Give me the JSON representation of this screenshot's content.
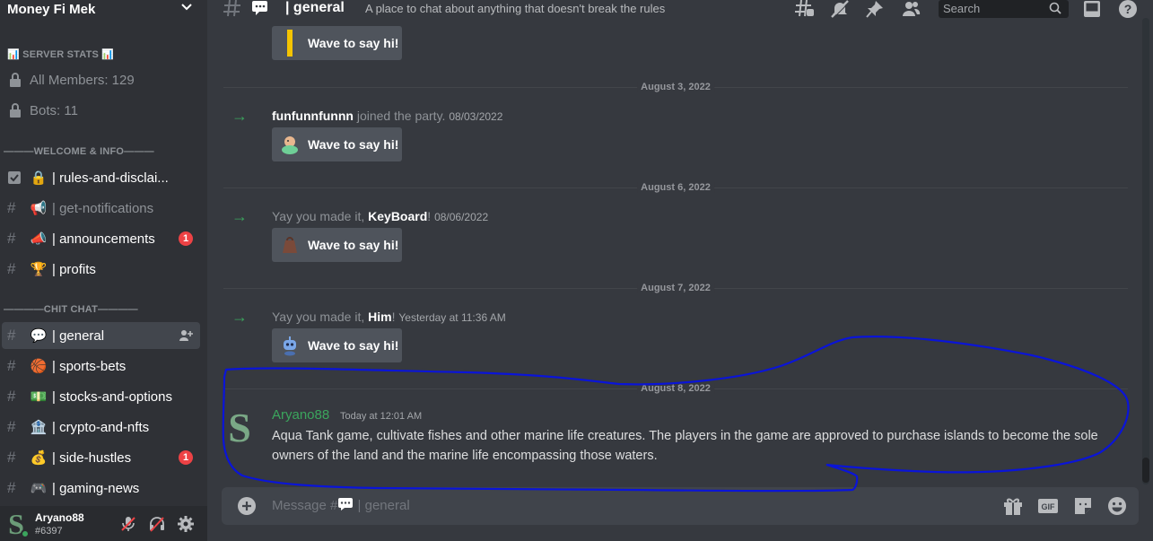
{
  "server": {
    "name": "Money Fi Mek"
  },
  "sidebar": {
    "stats_category": "📊 SERVER STATS 📊",
    "stats": [
      "All Members: 129",
      "Bots: 11"
    ],
    "welcome_category": "———WELCOME & INFO———",
    "welcome_channels": [
      {
        "label": "| rules-and-disclai...",
        "emoji": "🔒"
      },
      {
        "label": "| get-notifications",
        "emoji": "📢"
      },
      {
        "label": "| announcements",
        "emoji": "📣",
        "badge": "1"
      },
      {
        "label": "| profits",
        "emoji": "🏆"
      }
    ],
    "chat_category": "————CHIT CHAT————",
    "chat_channels": [
      {
        "label": "| general",
        "emoji": "💬",
        "active": true
      },
      {
        "label": "| sports-bets",
        "emoji": "🏀"
      },
      {
        "label": "| stocks-and-options",
        "emoji": "💵"
      },
      {
        "label": "| crypto-and-nfts",
        "emoji": "🏦"
      },
      {
        "label": "| side-hustles",
        "emoji": "💰",
        "badge": "1"
      },
      {
        "label": "| gaming-news",
        "emoji": "🎮"
      }
    ]
  },
  "user": {
    "name": "Aryano88",
    "tag": "#6397",
    "avatar_letter": "S"
  },
  "topbar": {
    "channel": "| general",
    "topic": "A place to chat about anything that doesn't break the rules",
    "search_placeholder": "Search"
  },
  "messages": {
    "wave_label": "Wave to say hi!",
    "dates": [
      "August 3, 2022",
      "August 6, 2022",
      "August 7, 2022",
      "August 8, 2022"
    ],
    "joins": [
      {
        "pre": "",
        "name": "funfunnfunnn",
        "post": " joined the party.",
        "time": "08/03/2022"
      },
      {
        "pre": "Yay you made it, ",
        "name": "KeyBoard",
        "post": "!",
        "time": "08/06/2022"
      },
      {
        "pre": "Yay you made it, ",
        "name": "Him",
        "post": "!",
        "time": "Yesterday at 11:36 AM"
      }
    ],
    "post": {
      "author": "Aryano88",
      "time": "Today at 12:01 AM",
      "text": "Aqua Tank game, cultivate fishes and other marine life creatures. The players in the game are approved to purchase islands to become the sole owners of the land and the marine life encompassing those waters."
    }
  },
  "composer": {
    "placeholder_prefix": "Message #",
    "placeholder_channel": "| general"
  },
  "colors": {
    "accent_green": "#3ba55d",
    "badge_red": "#ed4245",
    "annotation_blue": "#0a14d8"
  }
}
